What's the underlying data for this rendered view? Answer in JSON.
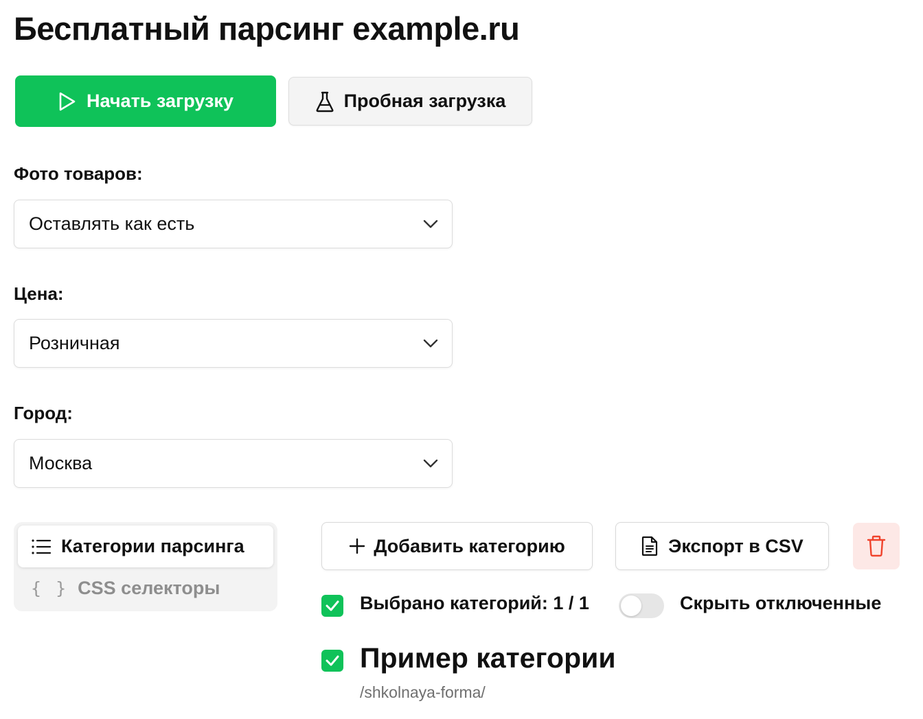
{
  "page": {
    "title": "Бесплатный парсинг example.ru"
  },
  "toolbar": {
    "start_label": "Начать загрузку",
    "trial_label": "Пробная загрузка"
  },
  "fields": {
    "photos": {
      "label": "Фото товаров:",
      "value": "Оставлять как есть"
    },
    "price": {
      "label": "Цена:",
      "value": "Розничная"
    },
    "city": {
      "label": "Город:",
      "value": "Москва"
    }
  },
  "tabs": {
    "categories": "Категории парсинга",
    "selectors_icon": "{ }",
    "selectors": "CSS селекторы"
  },
  "actions": {
    "add_category": "Добавить категорию",
    "export_csv": "Экспорт в CSV"
  },
  "status": {
    "selected_count": "Выбрано категорий: 1 / 1",
    "hide_disabled": "Скрыть отключенные",
    "hide_disabled_on": false
  },
  "category": {
    "title": "Пример категории",
    "slug": "/shkolnaya-forma/",
    "checked": true
  },
  "colors": {
    "accent": "#0fc259",
    "danger": "#f0432c",
    "danger_bg": "#fde8e6"
  },
  "icons": {
    "start": "play-icon",
    "trial": "flask-icon",
    "dropdown": "chevron-down-icon",
    "categories_tab": "list-icon",
    "add": "plus-icon",
    "export": "document-icon",
    "delete": "trash-icon",
    "check": "check-icon"
  }
}
